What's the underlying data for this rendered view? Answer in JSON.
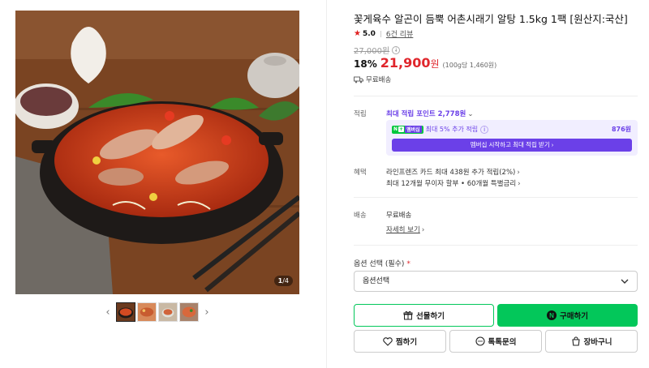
{
  "gallery": {
    "counter_current": "1",
    "counter_total": "/4",
    "prev_glyph": "‹",
    "next_glyph": "›",
    "thumbnails": [
      "thumb-stew-pot",
      "thumb-soup-closeup",
      "thumb-bowl",
      "thumb-serving"
    ]
  },
  "product": {
    "title": "꽃게육수 알곤이 듬뿍 어촌시래기 알탕 1.5kg 1팩 [원산지:국산]",
    "rating_star": "★",
    "rating_score": "5.0",
    "review_count": "6건 리뷰",
    "original_price": "27,000원",
    "discount": "18%",
    "sale_price": "21,900",
    "sale_currency": "원",
    "unit_price": "(100g당 1,460원)",
    "shipping_summary": "무료배송"
  },
  "points": {
    "label": "적립",
    "max_point_link": "최대 적립 포인트 2,778원",
    "npay_badge_n": "N",
    "npay_badge_plus": "+",
    "npay_badge_member": "멤버십",
    "npay_extra": "최대 5% 추가 적립",
    "npay_amount": "876원",
    "npay_button": "멤버십 시작하고 최대 적립 받기 ›"
  },
  "benefits": {
    "label": "혜택",
    "line1": "라인프렌즈 카드 최대 438원 추가 적립(2%)",
    "line2": "최대 12개월 무이자 할부 • 60개월 특별금리"
  },
  "delivery": {
    "label": "배송",
    "value": "무료배송",
    "detail_link": "자세히 보기"
  },
  "options": {
    "label": "옵션 선택 (필수)",
    "required_mark": "*",
    "selected": "옵션선택"
  },
  "actions": {
    "gift": "선물하기",
    "buy": "구매하기",
    "buy_n": "N",
    "wishlist": "찜하기",
    "talk": "톡톡문의",
    "cart": "장바구니"
  },
  "colors": {
    "accent_green": "#03c75a",
    "sale_red": "#e0262c",
    "membership_purple": "#6b40e8"
  }
}
